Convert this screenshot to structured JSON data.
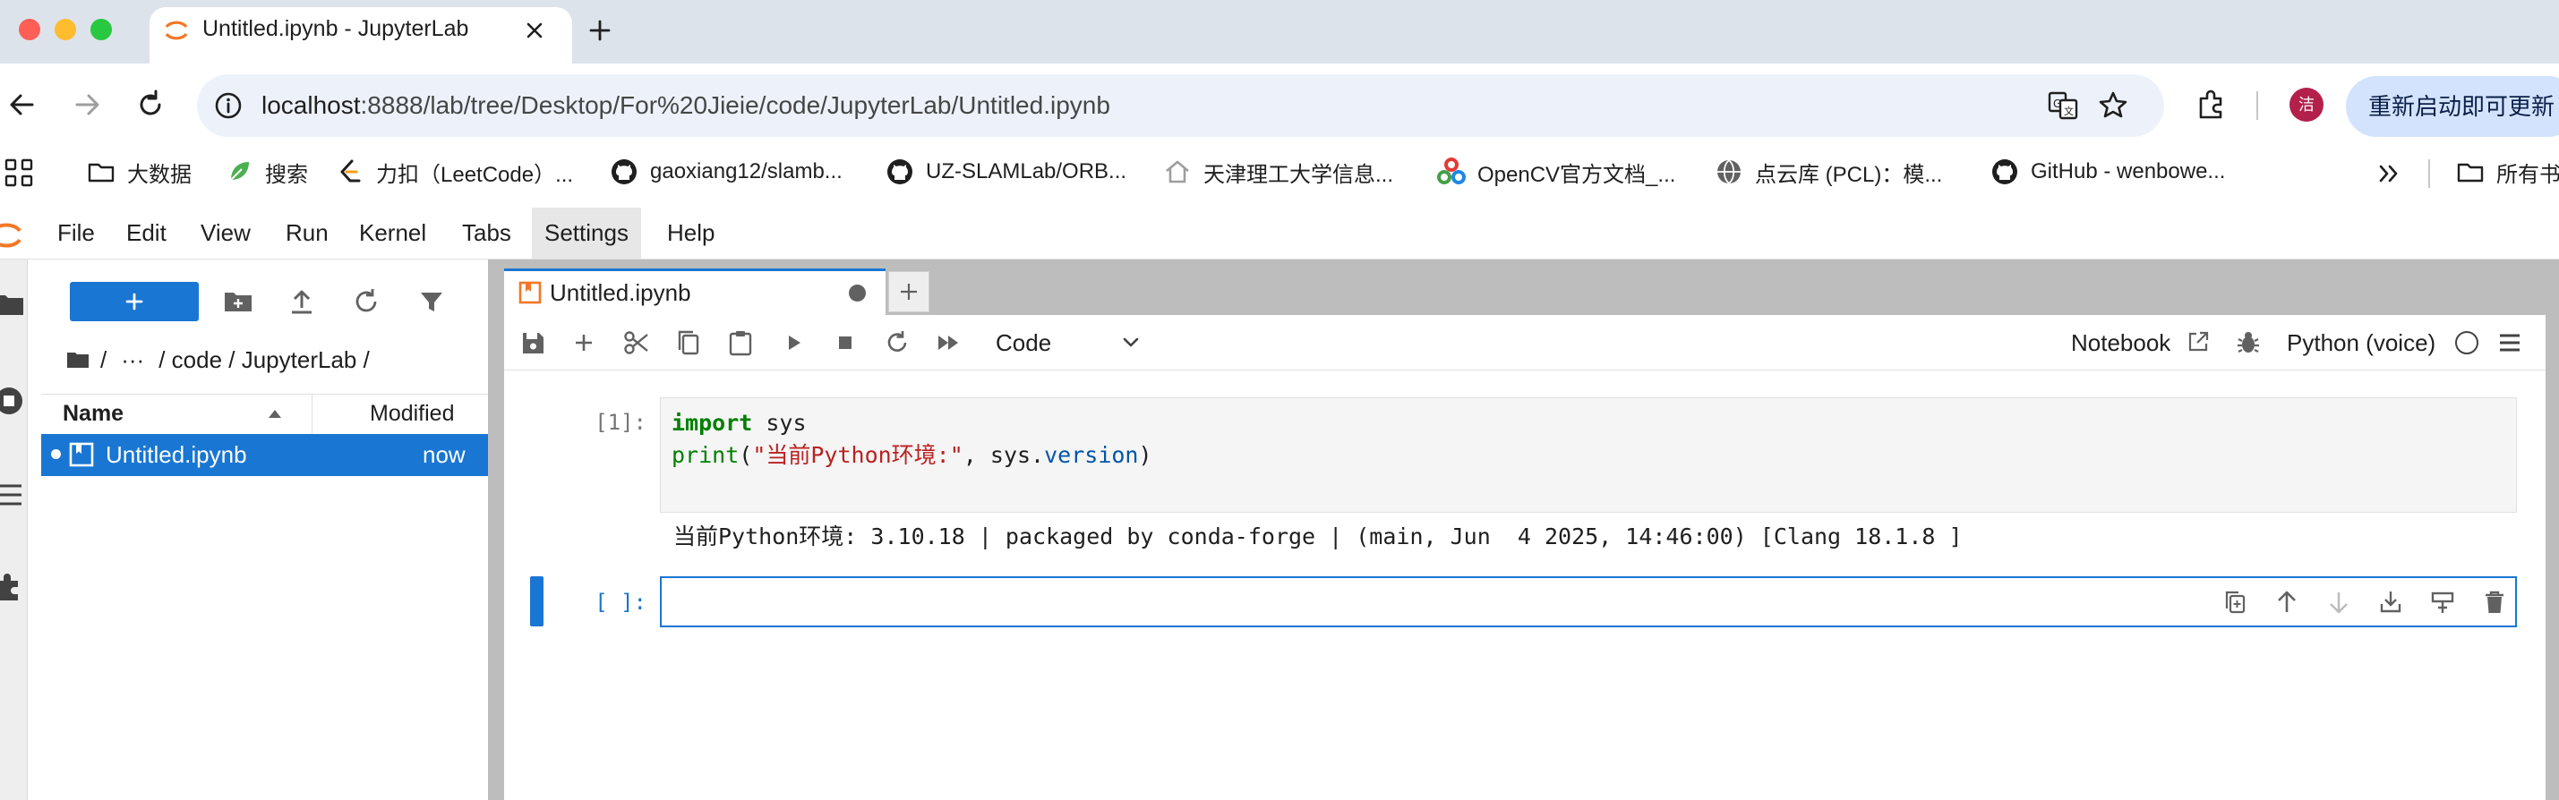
{
  "browser": {
    "tab_title": "Untitled.ipynb - JupyterLab",
    "url_host": "localhost",
    "url_rest": ":8888/lab/tree/Desktop/For%20Jieie/code/JupyterLab/Untitled.ipynb",
    "avatar_text": "洁",
    "restart_label": "重新启动即可更新",
    "bookmarks": [
      {
        "icon": "folder-icon",
        "label": "大数据"
      },
      {
        "icon": "search-leaf-icon",
        "label": "搜索"
      },
      {
        "icon": "leetcode-icon",
        "label": "力扣（LeetCode）..."
      },
      {
        "icon": "github-icon",
        "label": "gaoxiang12/slamb..."
      },
      {
        "icon": "github-icon",
        "label": "UZ-SLAMLab/ORB..."
      },
      {
        "icon": "home-icon",
        "label": "天津理工大学信息..."
      },
      {
        "icon": "opencv-icon",
        "label": "OpenCV官方文档_..."
      },
      {
        "icon": "globe-icon",
        "label": "点云库 (PCL)：模..."
      },
      {
        "icon": "github-icon",
        "label": "GitHub - wenbowe..."
      }
    ],
    "bookmarks_folder_label": "所有书"
  },
  "jupyter": {
    "menu": [
      "File",
      "Edit",
      "View",
      "Run",
      "Kernel",
      "Tabs",
      "Settings",
      "Help"
    ],
    "active_menu": "Settings",
    "filebrowser": {
      "breadcrumb_sep": "/",
      "breadcrumb_ellipsis": "···",
      "breadcrumb_path": "/ code / JupyterLab /",
      "col_name": "Name",
      "col_modified": "Modified",
      "files": [
        {
          "name": "Untitled.ipynb",
          "modified": "now",
          "selected": true
        }
      ]
    },
    "notebook": {
      "tab_title": "Untitled.ipynb",
      "cell_type": "Code",
      "notebook_label": "Notebook",
      "kernel": "Python (voice)",
      "cells": [
        {
          "prompt": "[1]:",
          "code_line1_kw": "import",
          "code_line1_rest": " sys",
          "code_line2_fn": "print",
          "code_line2_open": "(",
          "code_line2_str": "\"当前Python环境:\"",
          "code_line2_mid": ", sys.",
          "code_line2_attr": "version",
          "code_line2_close": ")",
          "output": "当前Python环境: 3.10.18 | packaged by conda-forge | (main, Jun  4 2025, 14:46:00) [Clang 18.1.8 ]"
        },
        {
          "prompt": "[ ]:"
        }
      ]
    }
  },
  "colors": {
    "accent": "#1976d2",
    "chrome_tabstrip": "#dde3ea",
    "omnibox": "#edf2fa",
    "restart_button": "#d3e3fd",
    "avatar": "#b3204c",
    "jupyter_orange": "#f37726",
    "splitter_gray": "#bdbdbd"
  }
}
